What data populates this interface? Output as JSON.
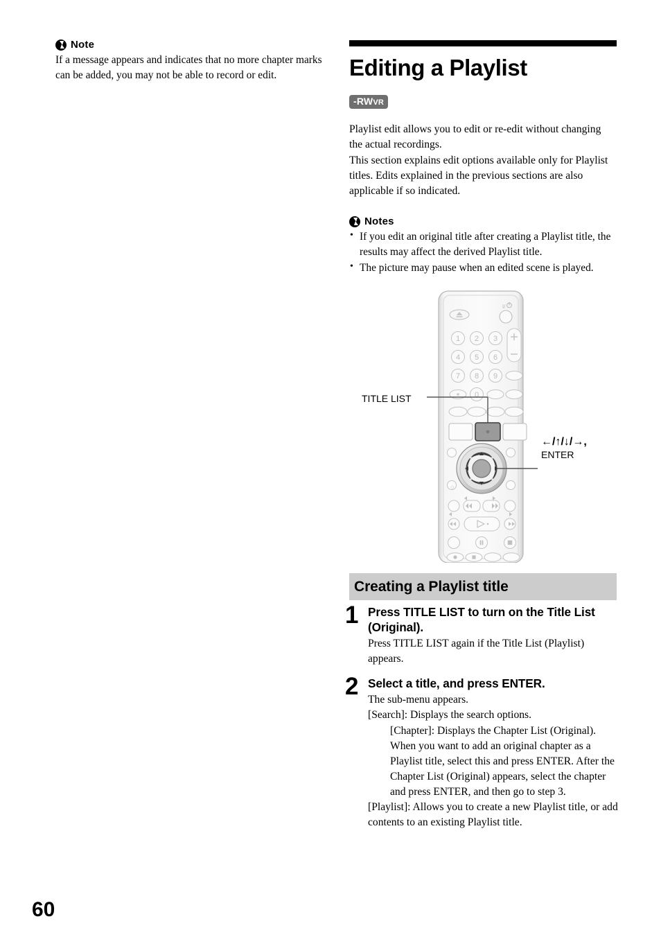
{
  "left_column": {
    "note_heading": "Note",
    "note_icon": "bolt-circle-icon",
    "note_text": "If a message appears and indicates that no more chapter marks can be added, you may not be able to record or edit."
  },
  "right_column": {
    "title": "Editing a Playlist",
    "disc_badge": {
      "main": "-RW",
      "sub": "VR"
    },
    "intro_paragraph_1": "Playlist edit allows you to edit or re-edit without changing the actual recordings.",
    "intro_paragraph_2": "This section explains edit options available only for Playlist titles. Edits explained in the previous sections are also applicable if so indicated.",
    "notes_heading": "Notes",
    "notes_icon": "bolt-circle-icon",
    "notes": [
      "If you edit an original title after creating a Playlist title, the results may affect the derived Playlist title.",
      "The picture may pause when an edited scene is played."
    ]
  },
  "figure": {
    "name": "remote-control-diagram",
    "callouts": {
      "left_label": "TITLE LIST",
      "right_arrows": "←/↑/↓/→,",
      "right_label": "ENTER"
    },
    "keypad_digits": [
      "1",
      "2",
      "3",
      "4",
      "5",
      "6",
      "7",
      "8",
      "9",
      "0"
    ],
    "power_symbol": "I/⏻",
    "eject_symbol": "eject-icon"
  },
  "section": {
    "header": "Creating a Playlist title",
    "steps": [
      {
        "number": "1",
        "title": "Press TITLE LIST to turn on the Title List (Original).",
        "body": [
          {
            "indent": 0,
            "text": "Press TITLE LIST again if the Title List (Playlist) appears."
          }
        ]
      },
      {
        "number": "2",
        "title": "Select a title, and press ENTER.",
        "body": [
          {
            "indent": 0,
            "text": "The sub-menu appears."
          },
          {
            "indent": 0,
            "text": "[Search]: Displays the search options."
          },
          {
            "indent": 1,
            "text": "[Chapter]: Displays the Chapter List (Original). When you want to add an original chapter as a Playlist title, select this and press ENTER. After the Chapter List (Original) appears, select the chapter and press ENTER, and then go to step 3."
          },
          {
            "indent": 0,
            "text": "[Playlist]: Allows you to create a new Playlist title, or add contents to an existing Playlist title."
          }
        ]
      }
    ]
  },
  "footer": {
    "page_number": "60"
  },
  "colors": {
    "rule_bar": "#000000",
    "section_header_bg": "#cccccc",
    "badge_bg": "#6f6f6f",
    "remote_body": "#f2f2f2",
    "highlight_key": "#9a9a9a"
  }
}
